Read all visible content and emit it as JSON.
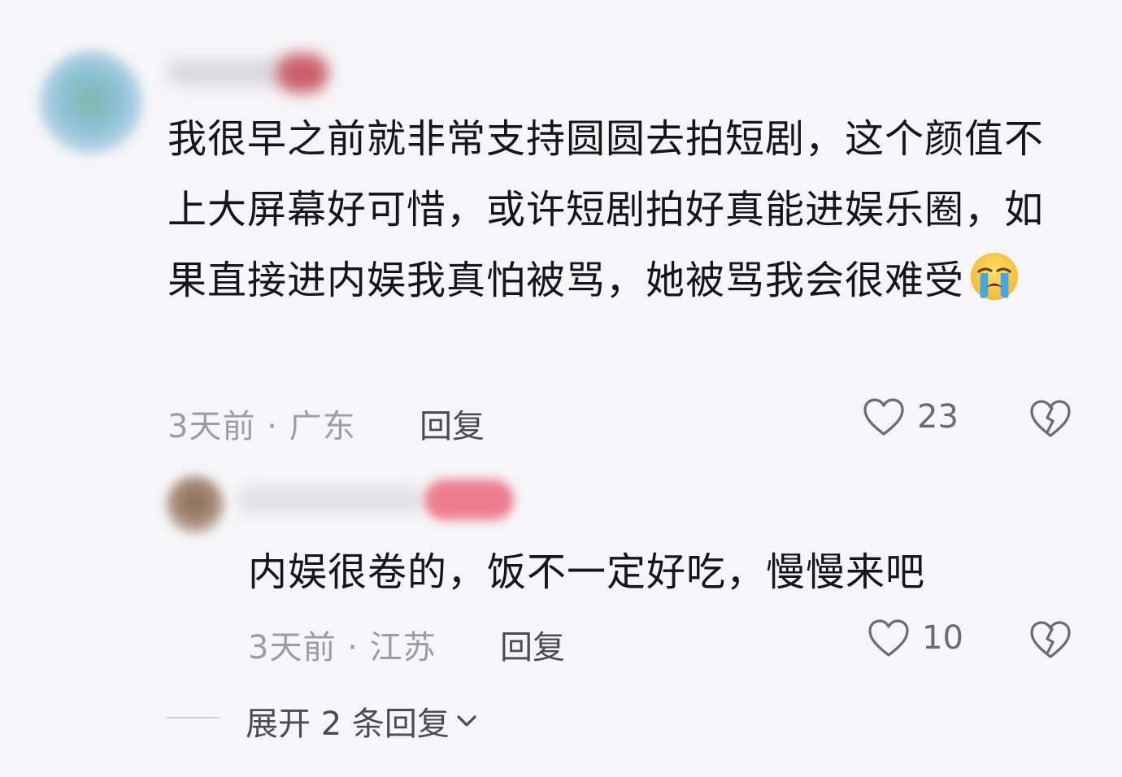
{
  "comment": {
    "text": "我很早之前就非常支持圆圆去拍短剧，这个颜值不上大屏幕好可惜，或许短剧拍好真能进娱乐圈，如果直接进内娱我真怕被骂，她被骂我会很难受",
    "emoji": "loudly-crying-face",
    "meta": "3天前 · 广东",
    "reply_label": "回复",
    "likes": "23"
  },
  "reply": {
    "text": "内娱很卷的，饭不一定好吃，慢慢来吧",
    "meta": "3天前 · 江苏",
    "reply_label": "回复",
    "likes": "10"
  },
  "expand": {
    "label": "展开 2 条回复"
  },
  "colors": {
    "background": "#f6f6f8",
    "text": "#161618",
    "meta": "#9c9ca4",
    "reply_badge": "#ee7e8f"
  }
}
